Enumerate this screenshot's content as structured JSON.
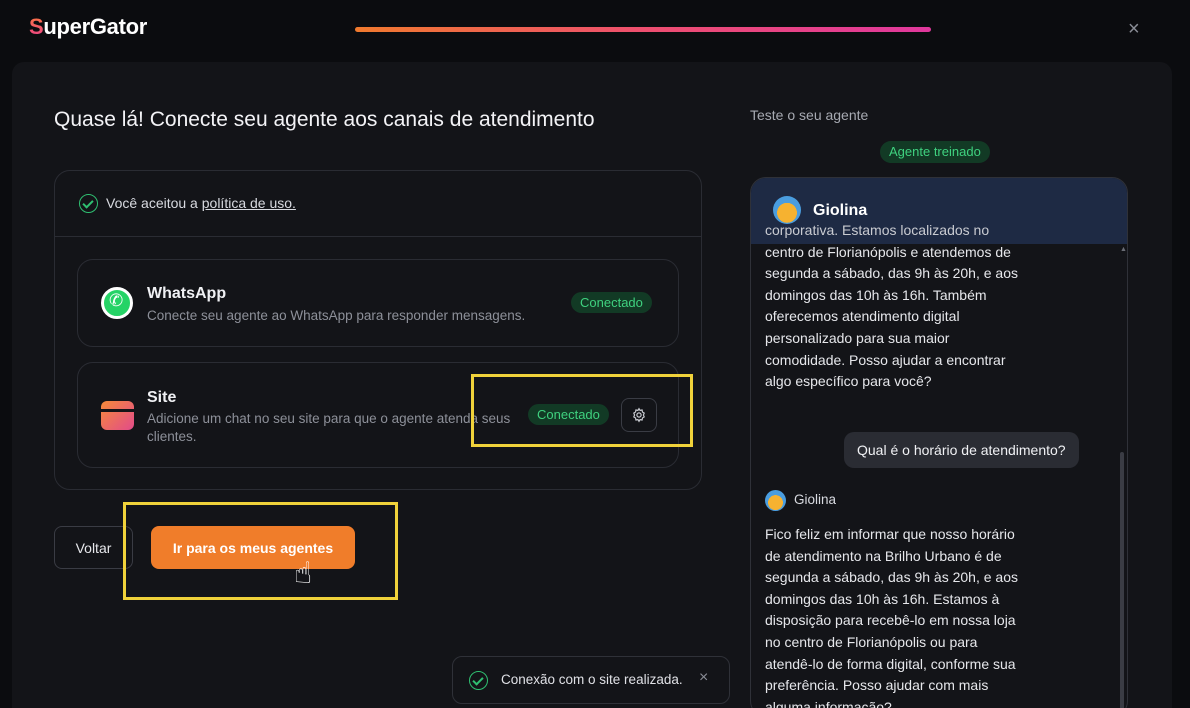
{
  "app": {
    "logo_first": "S",
    "logo_rest": "uperGator",
    "close_symbol": "×",
    "progress_percent": 100
  },
  "page": {
    "title": "Quase lá! Conecte seu agente aos canais de atendimento"
  },
  "policy": {
    "prefix": "Você aceitou a ",
    "link": "política de uso."
  },
  "channels": [
    {
      "name": "WhatsApp",
      "description": "Conecte seu agente ao WhatsApp para responder mensagens.",
      "status": "Conectado",
      "icon": "whatsapp-icon"
    },
    {
      "name": "Site",
      "description_line1": "Adicione um chat no seu site para que o agente atenda seus",
      "description_line2": "clientes.",
      "status": "Conectado",
      "icon": "site-icon",
      "settings_icon": "gear-icon"
    }
  ],
  "actions": {
    "back": "Voltar",
    "go": "Ir para os meus agentes"
  },
  "toast": {
    "text": "Conexão com o site realizada.",
    "close_symbol": "×"
  },
  "test": {
    "label": "Teste o seu agente",
    "badge": "Agente treinado"
  },
  "chat": {
    "agent_name": "Giolina",
    "bot_message_1": [
      "corporativa. Estamos localizados no",
      "centro de Florianópolis e atendemos de",
      "segunda a sábado, das 9h às 20h, e aos",
      "domingos das 10h às 16h. Também",
      "oferecemos atendimento digital",
      "personalizado para sua maior",
      "comodidade. Posso ajudar a encontrar",
      "algo específico para você?"
    ],
    "user_message": "Qual é o horário de atendimento?",
    "bot_message_2": [
      "Fico feliz em informar que nosso horário",
      "de atendimento na Brilho Urbano é de",
      "segunda a sábado, das 9h às 20h, e aos",
      "domingos das 10h às 16h. Estamos à",
      "disposição para recebê-lo em nossa loja",
      "no centro de Florianópolis ou para",
      "atendê-lo de forma digital, conforme sua",
      "preferência. Posso ajudar com mais",
      "alguma informação?"
    ]
  },
  "colors": {
    "accent_orange": "#f07d2a",
    "badge_green": "#3fd17f",
    "highlight_yellow": "#f0d23a",
    "chat_header": "#1e2a44"
  }
}
